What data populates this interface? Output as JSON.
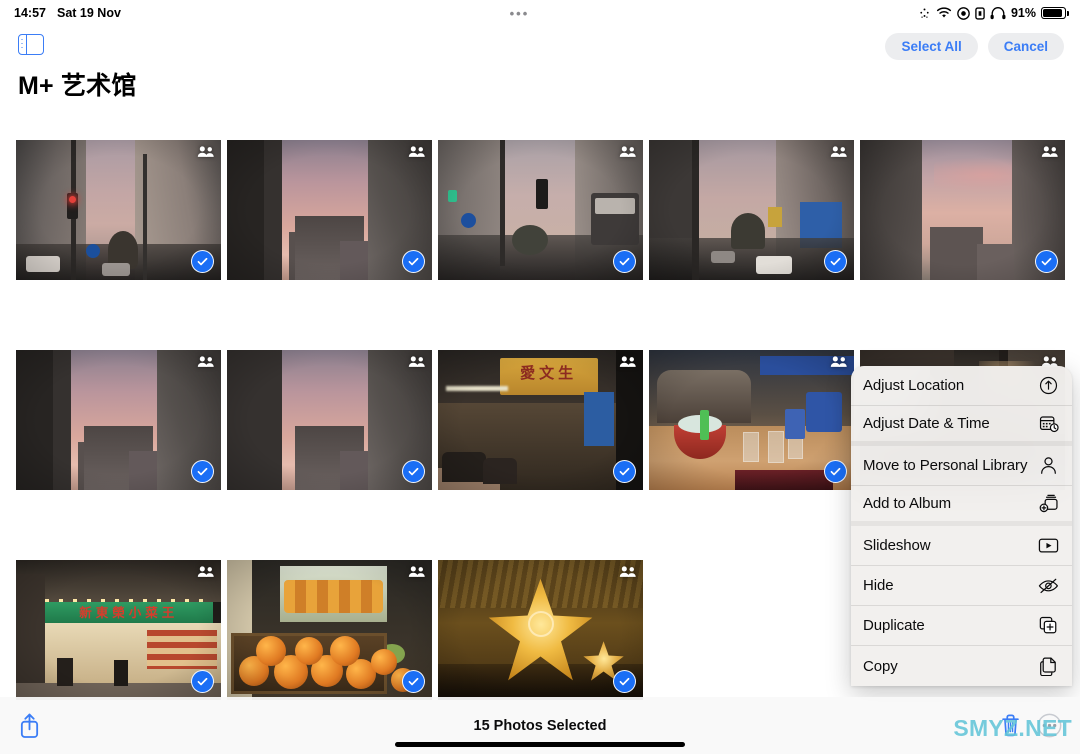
{
  "status_bar": {
    "time": "14:57",
    "date": "Sat 19 Nov",
    "center_handle": "•••",
    "battery_percent": "91%",
    "battery_level": 91,
    "icons": [
      "airdrop-icon",
      "wifi-icon",
      "do-not-disturb-icon",
      "lock-portrait-icon",
      "headphones-icon"
    ]
  },
  "nav": {
    "sidebar_toggle_icon": "sidebar-toggle-icon",
    "title": "M+ 艺术馆",
    "select_all_label": "Select All",
    "cancel_label": "Cancel",
    "accent_color": "#3b7df6",
    "pill_bg": "#ecedef"
  },
  "grid": {
    "columns": 5,
    "photos": [
      {
        "id": 1,
        "caption": "Hong Kong street with traffic lights at dusk",
        "shared": true,
        "selected": true
      },
      {
        "id": 2,
        "caption": "Pink dusk sky between tall buildings",
        "shared": true,
        "selected": true
      },
      {
        "id": 3,
        "caption": "Busy city street with bus and traffic lights",
        "shared": true,
        "selected": true
      },
      {
        "id": 4,
        "caption": "Street with palm tree and blue construction wall",
        "shared": true,
        "selected": true
      },
      {
        "id": 5,
        "caption": "Dusk sky over rooftops",
        "shared": true,
        "selected": true
      },
      {
        "id": 6,
        "caption": "Dusk sky between buildings",
        "shared": true,
        "selected": true
      },
      {
        "id": 7,
        "caption": "Dark buildings against pink sky",
        "shared": true,
        "selected": true
      },
      {
        "id": 8,
        "caption": "Restaurant with yellow sign 愛文生",
        "sign_text": "愛文生",
        "shared": true,
        "selected": true
      },
      {
        "id": 9,
        "caption": "Table with red bowl and blue containers",
        "shared": true,
        "selected": true
      },
      {
        "id": 10,
        "caption": "Night street market crowd",
        "shared": true,
        "selected": true
      },
      {
        "id": 11,
        "caption": "Restaurant with green sign 新東榮小菜王",
        "sign_text": "新東榮小菜王",
        "shared": true,
        "selected": true
      },
      {
        "id": 12,
        "caption": "Fruit stall with crate of oranges",
        "shared": true,
        "selected": true
      },
      {
        "id": 13,
        "caption": "Golden star Christmas decoration in mall",
        "shared": true,
        "selected": true
      }
    ],
    "shared_badge_icon": "shared-library-people-icon",
    "check_icon": "checkmark-circle-icon",
    "check_color": "#1a6ef5"
  },
  "context_menu": {
    "items": [
      {
        "label": "Adjust Location",
        "icon": "location-arrow-circle-icon",
        "group": 1
      },
      {
        "label": "Adjust Date & Time",
        "icon": "calendar-clock-icon",
        "group": 1
      },
      {
        "label": "Move to Personal Library",
        "icon": "person-icon",
        "group": 2
      },
      {
        "label": "Add to Album",
        "icon": "add-to-album-icon",
        "group": 2
      },
      {
        "label": "Slideshow",
        "icon": "play-rectangle-icon",
        "group": 3
      },
      {
        "label": "Hide",
        "icon": "eye-slash-icon",
        "group": 3
      },
      {
        "label": "Duplicate",
        "icon": "duplicate-plus-icon",
        "group": 3
      },
      {
        "label": "Copy",
        "icon": "copy-documents-icon",
        "group": 3
      }
    ]
  },
  "toolbar": {
    "share_icon": "share-up-arrow-icon",
    "status_text": "15 Photos Selected",
    "trash_icon": "trash-icon",
    "more_icon": "more-ellipsis-circle-icon",
    "icon_color": "#3b7df6"
  },
  "watermark": {
    "text": "SMYZ.NET",
    "color": "#63c5d8"
  }
}
